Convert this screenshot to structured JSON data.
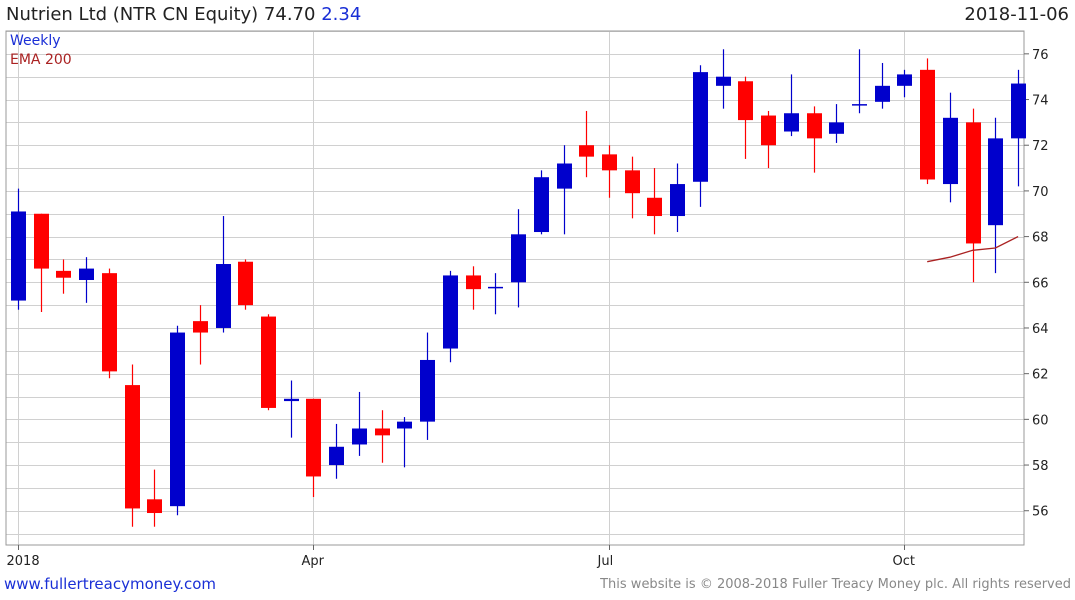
{
  "header": {
    "security": "Nutrien Ltd (NTR CN Equity)",
    "last": "74.70",
    "change": "2.34",
    "date": "2018-11-06"
  },
  "footer": {
    "website": "www.fullertreacymoney.com",
    "copyright": "This website is © 2008-2018 Fuller Treacy Money plc. All rights reserved"
  },
  "colors": {
    "up": "#0000cc",
    "down": "#ff0000",
    "ema": "#aa2222",
    "grid": "#d0d0d0"
  },
  "chart_data": {
    "type": "candlestick",
    "legend": [
      {
        "label": "Weekly",
        "color": "#1a2fd6"
      },
      {
        "label": "EMA 200",
        "color": "#aa2222"
      }
    ],
    "ylim": [
      54.5,
      77
    ],
    "yticks": [
      56,
      58,
      60,
      62,
      64,
      66,
      68,
      70,
      72,
      74,
      76
    ],
    "grid": true,
    "x_tick_labels": [
      {
        "label": "2018",
        "week": 0
      },
      {
        "label": "Apr",
        "week": 13
      },
      {
        "label": "Jul",
        "week": 26
      },
      {
        "label": "Oct",
        "week": 39
      }
    ],
    "candles": [
      {
        "week": 0,
        "o": 65.2,
        "h": 70.1,
        "l": 64.8,
        "c": 69.1
      },
      {
        "week": 1,
        "o": 69.0,
        "h": 69.0,
        "l": 64.7,
        "c": 66.6
      },
      {
        "week": 2,
        "o": 66.5,
        "h": 67.0,
        "l": 65.5,
        "c": 66.2
      },
      {
        "week": 3,
        "o": 66.1,
        "h": 67.1,
        "l": 65.1,
        "c": 66.6
      },
      {
        "week": 4,
        "o": 66.4,
        "h": 66.6,
        "l": 61.8,
        "c": 62.1
      },
      {
        "week": 5,
        "o": 61.5,
        "h": 62.4,
        "l": 55.3,
        "c": 56.1
      },
      {
        "week": 6,
        "o": 56.5,
        "h": 57.8,
        "l": 55.3,
        "c": 55.9
      },
      {
        "week": 7,
        "o": 56.2,
        "h": 64.1,
        "l": 55.8,
        "c": 63.8
      },
      {
        "week": 8,
        "o": 64.3,
        "h": 65.0,
        "l": 62.4,
        "c": 63.8
      },
      {
        "week": 9,
        "o": 64.0,
        "h": 68.9,
        "l": 63.8,
        "c": 66.8
      },
      {
        "week": 10,
        "o": 66.9,
        "h": 67.0,
        "l": 64.8,
        "c": 65.0
      },
      {
        "week": 11,
        "o": 64.5,
        "h": 64.6,
        "l": 60.4,
        "c": 60.5
      },
      {
        "week": 12,
        "o": 60.8,
        "h": 61.7,
        "l": 59.2,
        "c": 60.9
      },
      {
        "week": 13,
        "o": 60.9,
        "h": 60.9,
        "l": 56.6,
        "c": 57.5
      },
      {
        "week": 14,
        "o": 58.0,
        "h": 59.8,
        "l": 57.4,
        "c": 58.8
      },
      {
        "week": 15,
        "o": 58.9,
        "h": 61.2,
        "l": 58.4,
        "c": 59.6
      },
      {
        "week": 16,
        "o": 59.6,
        "h": 60.4,
        "l": 58.1,
        "c": 59.3
      },
      {
        "week": 17,
        "o": 59.6,
        "h": 60.1,
        "l": 57.9,
        "c": 59.9
      },
      {
        "week": 18,
        "o": 59.9,
        "h": 63.8,
        "l": 59.1,
        "c": 62.6
      },
      {
        "week": 19,
        "o": 63.1,
        "h": 66.5,
        "l": 62.5,
        "c": 66.3
      },
      {
        "week": 20,
        "o": 66.3,
        "h": 66.7,
        "l": 64.8,
        "c": 65.7
      },
      {
        "week": 21,
        "o": 65.8,
        "h": 66.4,
        "l": 64.6,
        "c": 65.8
      },
      {
        "week": 22,
        "o": 66.0,
        "h": 69.2,
        "l": 64.9,
        "c": 68.1
      },
      {
        "week": 23,
        "o": 68.2,
        "h": 70.9,
        "l": 68.1,
        "c": 70.6
      },
      {
        "week": 24,
        "o": 70.1,
        "h": 72.0,
        "l": 68.1,
        "c": 71.2
      },
      {
        "week": 25,
        "o": 72.0,
        "h": 73.5,
        "l": 70.6,
        "c": 71.5
      },
      {
        "week": 26,
        "o": 71.6,
        "h": 72.0,
        "l": 69.7,
        "c": 70.9
      },
      {
        "week": 27,
        "o": 70.9,
        "h": 71.5,
        "l": 68.8,
        "c": 69.9
      },
      {
        "week": 28,
        "o": 69.7,
        "h": 71.0,
        "l": 68.1,
        "c": 68.9
      },
      {
        "week": 29,
        "o": 68.9,
        "h": 71.2,
        "l": 68.2,
        "c": 70.3
      },
      {
        "week": 30,
        "o": 70.4,
        "h": 75.5,
        "l": 69.3,
        "c": 75.2
      },
      {
        "week": 31,
        "o": 74.6,
        "h": 76.2,
        "l": 73.6,
        "c": 75.0
      },
      {
        "week": 32,
        "o": 74.8,
        "h": 75.0,
        "l": 71.4,
        "c": 73.1
      },
      {
        "week": 33,
        "o": 73.3,
        "h": 73.5,
        "l": 71.0,
        "c": 72.0
      },
      {
        "week": 34,
        "o": 72.6,
        "h": 75.1,
        "l": 72.4,
        "c": 73.4
      },
      {
        "week": 35,
        "o": 73.4,
        "h": 73.7,
        "l": 70.8,
        "c": 72.3
      },
      {
        "week": 36,
        "o": 72.5,
        "h": 73.8,
        "l": 72.1,
        "c": 73.0
      },
      {
        "week": 37,
        "o": 73.8,
        "h": 76.2,
        "l": 73.4,
        "c": 73.8
      },
      {
        "week": 38,
        "o": 73.9,
        "h": 75.6,
        "l": 73.6,
        "c": 74.6
      },
      {
        "week": 39,
        "o": 74.6,
        "h": 75.3,
        "l": 74.1,
        "c": 75.1
      },
      {
        "week": 40,
        "o": 75.3,
        "h": 75.8,
        "l": 70.3,
        "c": 70.5
      },
      {
        "week": 41,
        "o": 70.3,
        "h": 74.3,
        "l": 69.5,
        "c": 73.2
      },
      {
        "week": 42,
        "o": 73.0,
        "h": 73.6,
        "l": 66.0,
        "c": 67.7
      },
      {
        "week": 43,
        "o": 68.5,
        "h": 73.2,
        "l": 66.4,
        "c": 72.3
      },
      {
        "week": 44,
        "o": 72.3,
        "h": 75.3,
        "l": 70.2,
        "c": 74.7
      }
    ],
    "ema200": [
      {
        "week": 40,
        "v": 66.9
      },
      {
        "week": 41,
        "v": 67.1
      },
      {
        "week": 42,
        "v": 67.4
      },
      {
        "week": 43,
        "v": 67.5
      },
      {
        "week": 44,
        "v": 68.0
      }
    ]
  }
}
